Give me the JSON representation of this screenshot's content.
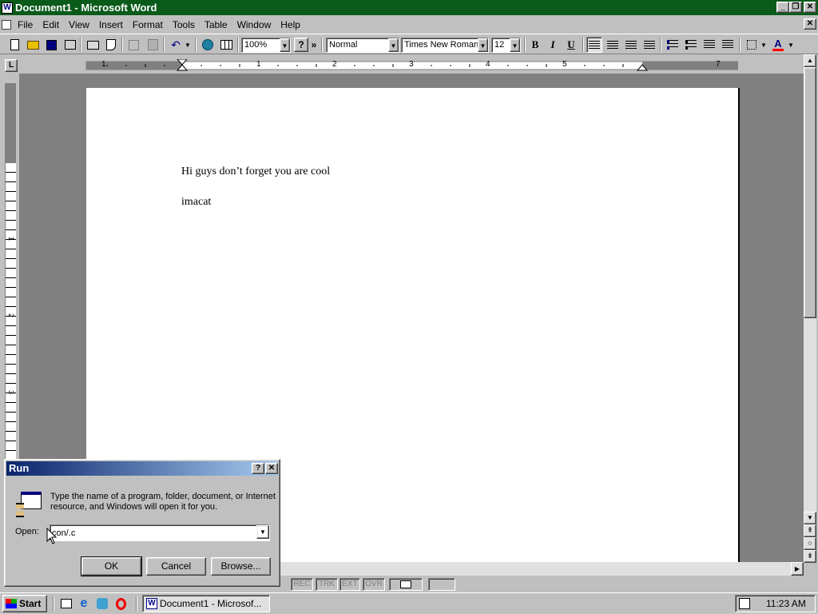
{
  "window": {
    "title": "Document1 - Microsoft Word",
    "controls": {
      "minimize": "_",
      "restore": "❐",
      "close": "✕"
    },
    "doc_close": "✕"
  },
  "menu": {
    "items": [
      {
        "label": "File",
        "hotkey": "F"
      },
      {
        "label": "Edit",
        "hotkey": "E"
      },
      {
        "label": "View",
        "hotkey": "V"
      },
      {
        "label": "Insert",
        "hotkey": "I"
      },
      {
        "label": "Format",
        "hotkey": "o"
      },
      {
        "label": "Tools",
        "hotkey": "T"
      },
      {
        "label": "Table",
        "hotkey": "a"
      },
      {
        "label": "Window",
        "hotkey": "W"
      },
      {
        "label": "Help",
        "hotkey": "H"
      }
    ]
  },
  "toolbar": {
    "zoom": "100%",
    "style": "Normal",
    "font": "Times New Roman",
    "size": "12",
    "bold": "B",
    "italic": "I",
    "underline": "U",
    "help": "?",
    "more": "»",
    "font_color_letter": "A",
    "font_color": "#ff0000"
  },
  "ruler": {
    "numbers": [
      "1",
      "1",
      "2",
      "3",
      "4",
      "5",
      "7"
    ],
    "tab_selector": "L"
  },
  "vruler": {
    "numbers": [
      "1",
      "2",
      "3"
    ]
  },
  "document": {
    "lines": [
      "Hi guys don’t forget you are cool",
      "imacat"
    ]
  },
  "statusbar": {
    "rec": "REC",
    "trk": "TRK",
    "ext": "EXT",
    "ovr": "OVR"
  },
  "run_dialog": {
    "title": "Run",
    "help_btn": "?",
    "close_btn": "✕",
    "description": "Type the name of a program, folder, document, or Internet resource, and Windows will open it for you.",
    "open_label": "Open:",
    "open_hotkey": "O",
    "open_value": "con/.c",
    "ok": "OK",
    "cancel": "Cancel",
    "browse": "Browse...",
    "browse_hotkey": "B"
  },
  "taskbar": {
    "start": "Start",
    "task": "Document1 - Microsof...",
    "clock": "11:23 AM"
  }
}
